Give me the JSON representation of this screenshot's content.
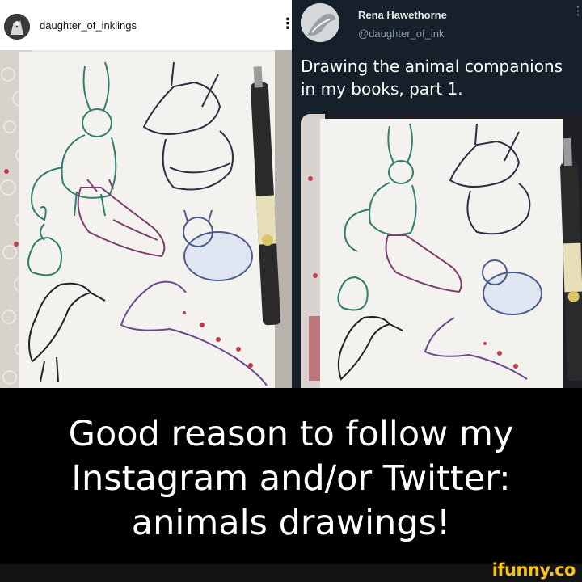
{
  "instagram": {
    "username": "daughter_of_inklings",
    "more_icon": "more-vertical-icon",
    "more_glyph": "⋮"
  },
  "twitter": {
    "name": "Rena Hawethorne",
    "handle": "@daughter_of_ink",
    "more_glyph": "⋮",
    "text": "Drawing the animal companions in my books, part 1."
  },
  "caption": {
    "line1": "Good reason to follow my",
    "line2": "Instagram and/or Twitter:",
    "line3": "animals drawings!"
  },
  "brand": {
    "label": "ifunny.co",
    "color": "#f6c21b"
  },
  "colors": {
    "twitter_bg": "#15202b",
    "instagram_bg": "#ffffff",
    "caption_bg": "#000000"
  }
}
